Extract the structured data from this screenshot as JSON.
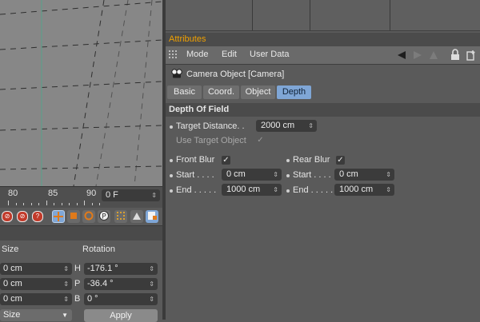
{
  "viewport": {},
  "timeline": {
    "labels": [
      "80",
      "85",
      "90"
    ],
    "frame_value": "0 F"
  },
  "coords": {
    "size_title": "Size",
    "rotation_title": "Rotation",
    "size_values": [
      "0 cm",
      "0 cm",
      "0 cm"
    ],
    "rotation_axes": [
      "H",
      "P",
      "B"
    ],
    "rotation_values": [
      "-176.1 °",
      "-36.4 °",
      "0 °"
    ],
    "mode_dropdown": "Size",
    "apply_label": "Apply"
  },
  "toolstrip": {
    "red_icons": [
      "⊘",
      "⊘",
      "?"
    ],
    "icon_names": [
      "render-view-icon",
      "render-settings-icon",
      "help-icon",
      "move-tool-icon",
      "scale-tool-icon",
      "rotate-tool-icon",
      "paint-icon",
      "grid-icon",
      "model-tool-icon",
      "object-tool-icon"
    ]
  },
  "attributes": {
    "title": "Attributes",
    "menu": [
      "Mode",
      "Edit",
      "User Data"
    ],
    "object_title": "Camera Object [Camera]",
    "tabs": [
      "Basic",
      "Coord.",
      "Object",
      "Depth"
    ],
    "active_tab": "Depth",
    "section": "Depth Of Field",
    "target_distance_label": "Target Distance. .",
    "target_distance_value": "2000 cm",
    "use_target_label": "Use Target Object",
    "use_target_check": "✓",
    "front_blur_label": "Front Blur",
    "front_blur_check": "✓",
    "rear_blur_label": "Rear Blur",
    "rear_blur_check": "✓",
    "front_start_label": "Start . . . .",
    "front_start_value": "0 cm",
    "front_end_label": "End . . . . .",
    "front_end_value": "1000 cm",
    "rear_start_label": "Start . . . .",
    "rear_start_value": "0 cm",
    "rear_end_label": "End . . . . .",
    "rear_end_value": "1000 cm"
  },
  "colors": {
    "accent_title": "#f0a000",
    "active_tab": "#7fa6d6",
    "field_bg": "#3b3b3b",
    "panel_bg": "#5a5a5a"
  }
}
